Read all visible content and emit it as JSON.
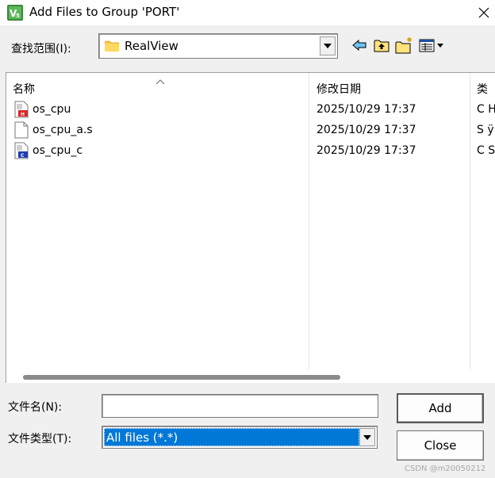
{
  "window": {
    "title": "Add Files to Group 'PORT'",
    "close_glyph": "✕"
  },
  "lookin": {
    "label": "查找范围(I):",
    "value": "RealView",
    "folder_icon": "folder-icon"
  },
  "toolbar": {
    "back_icon": "back-arrow-icon",
    "up_icon": "up-folder-icon",
    "new_folder_icon": "new-folder-icon",
    "view_menu_icon": "view-menu-icon"
  },
  "filelist": {
    "columns": {
      "name": "名称",
      "date": "修改日期",
      "type": "类"
    },
    "files": [
      {
        "name": "os_cpu",
        "date": "2025/10/29 17:37",
        "type": "C H",
        "icon": "header-file-icon"
      },
      {
        "name": "os_cpu_a.s",
        "date": "2025/10/29 17:37",
        "type": "S ÿ",
        "icon": "blank-file-icon"
      },
      {
        "name": "os_cpu_c",
        "date": "2025/10/29 17:37",
        "type": "C S",
        "icon": "c-file-icon"
      }
    ]
  },
  "filename": {
    "label": "文件名(N):",
    "value": ""
  },
  "filetype": {
    "label": "文件类型(T):",
    "value": "All files (*.*)"
  },
  "buttons": {
    "add": "Add",
    "close": "Close"
  },
  "watermark": "CSDN @m20050212",
  "colors": {
    "selection": "#0078d7",
    "dialog_bg": "#f0f0f0"
  }
}
